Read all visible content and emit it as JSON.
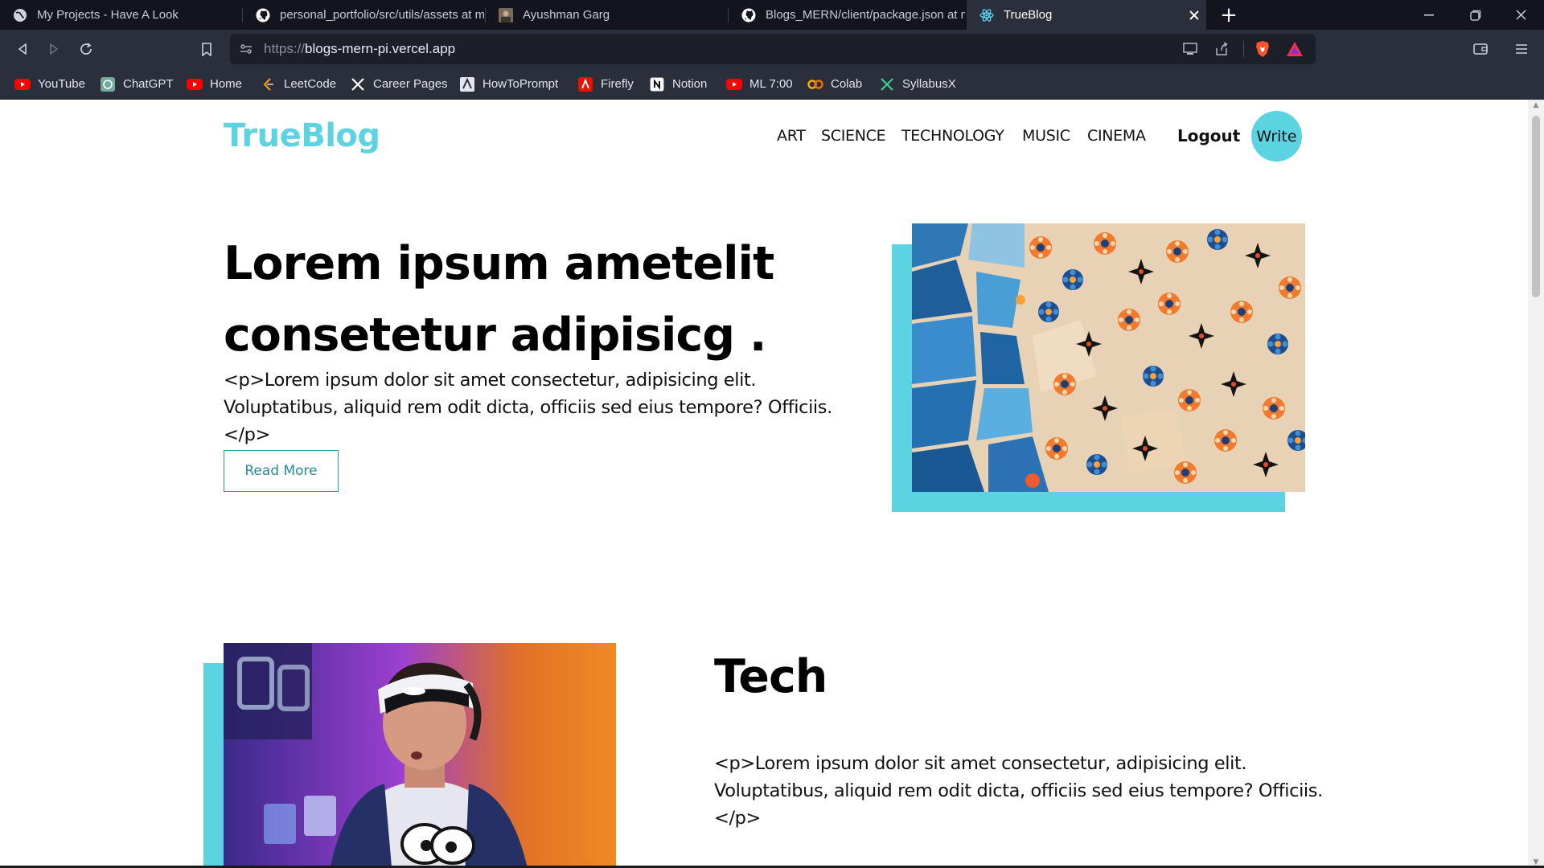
{
  "browser": {
    "tabs": [
      {
        "title": "My Projects - Have A Look",
        "icon": "globe-icon"
      },
      {
        "title": "personal_portfolio/src/utils/assets at m",
        "icon": "github-icon"
      },
      {
        "title": "Ayushman Garg",
        "icon": "photo-icon"
      },
      {
        "title": "Blogs_MERN/client/package.json at m",
        "icon": "github-icon"
      },
      {
        "title": "TrueBlog",
        "icon": "react-icon",
        "active": true
      }
    ],
    "new_tab": "+",
    "url_scheme": "https://",
    "url_host": "blogs-mern-pi.vercel.app",
    "bookmarks": [
      {
        "label": "YouTube",
        "icon": "youtube-icon"
      },
      {
        "label": "ChatGPT",
        "icon": "chatgpt-icon"
      },
      {
        "label": "Home",
        "icon": "youtube-icon"
      },
      {
        "label": "LeetCode",
        "icon": "leetcode-icon"
      },
      {
        "label": "Career Pages",
        "icon": "x-icon"
      },
      {
        "label": "HowToPrompt",
        "icon": "howtoprompt-icon"
      },
      {
        "label": "Firefly",
        "icon": "adobe-icon"
      },
      {
        "label": "Notion",
        "icon": "notion-icon"
      },
      {
        "label": "ML 7:00",
        "icon": "youtube-icon"
      },
      {
        "label": "Colab",
        "icon": "colab-icon"
      },
      {
        "label": "SyllabusX",
        "icon": "x-icon"
      }
    ]
  },
  "site": {
    "logo": "TrueBlog",
    "categories": [
      "ART",
      "SCIENCE",
      "TECHNOLOGY",
      "MUSIC",
      "CINEMA"
    ],
    "logout": "Logout",
    "write": "Write",
    "accent_color": "#5cd3e0"
  },
  "posts": [
    {
      "title": "Lorem ipsum ametelit consetetur adipisicg .",
      "desc": "<p>Lorem ipsum dolor sit amet consectetur, adipisicing elit. Voluptatibus, aliquid rem odit dicta, officiis sed eius tempore? Officiis.</p>",
      "button": "Read More"
    },
    {
      "title": "Tech",
      "desc": "<p>Lorem ipsum dolor sit amet consectetur, adipisicing elit. Voluptatibus, aliquid rem odit dicta, officiis sed eius tempore? Officiis.</p>"
    }
  ]
}
